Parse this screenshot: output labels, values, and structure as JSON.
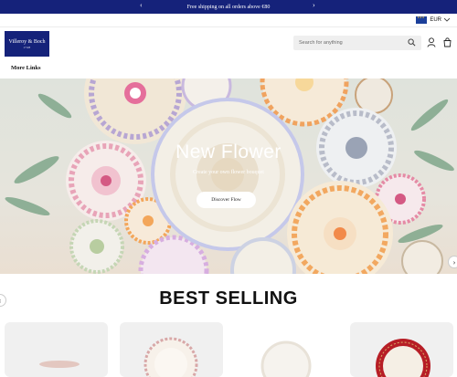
{
  "announcement": {
    "text": "Free shipping on all orders above €80",
    "prev_icon": "chevron-left-icon",
    "next_icon": "chevron-right-icon"
  },
  "currency": {
    "code": "EUR",
    "flag": "eu-flag-icon"
  },
  "brand": {
    "name": "Villeroy & Boch",
    "tagline": "1748"
  },
  "search": {
    "placeholder": "Search for anything"
  },
  "nav": {
    "more_links": "More Links"
  },
  "hero": {
    "title": "New Flower",
    "subtitle": "Create your own flower bouquet",
    "cta": "Discover Flow"
  },
  "best_selling": {
    "title": "BEST SELLING"
  },
  "colors": {
    "brand_navy": "#15227a",
    "hero_bg": "#e1e3dc"
  }
}
